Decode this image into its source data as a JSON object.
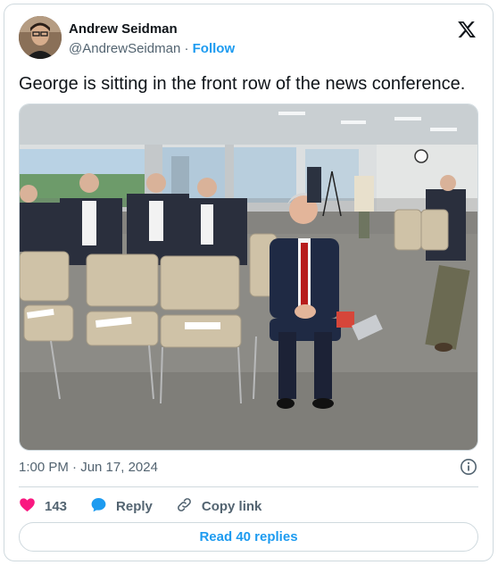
{
  "author": {
    "display_name": "Andrew Seidman",
    "handle": "@AndrewSeidman",
    "separator": "·",
    "follow_label": "Follow"
  },
  "tweet": {
    "text": "George is sitting in the front row of the news conference.",
    "timestamp": "1:00 PM · Jun 17, 2024"
  },
  "actions": {
    "like_count": "143",
    "reply_label": "Reply",
    "copy_link_label": "Copy link"
  },
  "read_replies_label": "Read 40 replies",
  "colors": {
    "accent": "#1d9bf0",
    "like": "#f91880",
    "secondary_text": "#536471",
    "border": "#cfd9de"
  },
  "icons": [
    "x-logo-icon",
    "info-icon",
    "heart-icon",
    "reply-bubble-icon",
    "link-icon"
  ]
}
